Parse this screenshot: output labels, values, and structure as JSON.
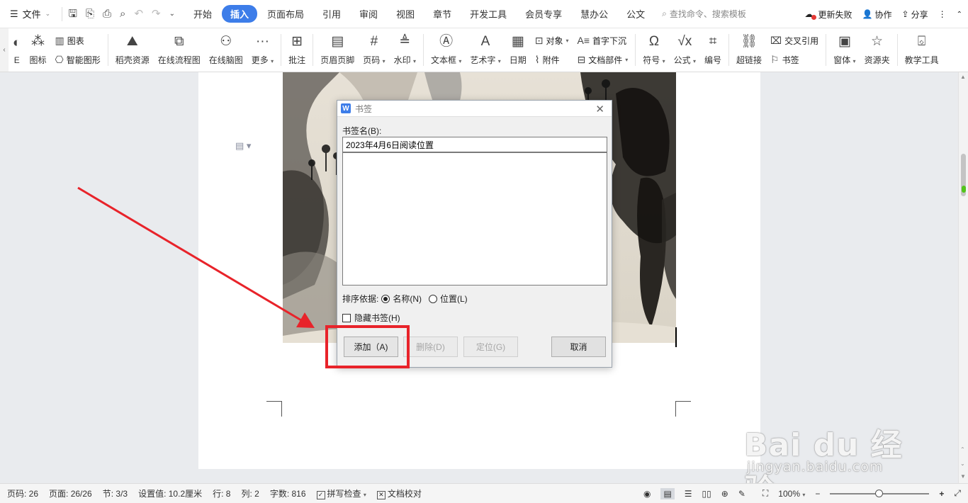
{
  "menubar": {
    "file_label": "文件",
    "tabs": [
      "开始",
      "插入",
      "页面布局",
      "引用",
      "审阅",
      "视图",
      "章节",
      "开发工具",
      "会员专享",
      "慧办公",
      "公文"
    ],
    "active_tab": "插入",
    "search_placeholder": "查找命令、搜索模板",
    "update_failed": "更新失败",
    "collab": "协作",
    "share": "分享"
  },
  "ribbon": {
    "partial_label": "E",
    "icon_label": "图标",
    "chart_label": "图表",
    "smartart_label": "智能图形",
    "docer_label": "稻壳资源",
    "flowchart_label": "在线流程图",
    "mindmap_label": "在线脑图",
    "more_label": "更多",
    "comment_label": "批注",
    "header_footer_label": "页眉页脚",
    "page_number_label": "页码",
    "watermark_label": "水印",
    "textbox_label": "文本框",
    "wordart_label": "艺术字",
    "date_label": "日期",
    "object_label": "对象",
    "attachment_label": "附件",
    "dropcap_label": "首字下沉",
    "docparts_label": "文档部件",
    "symbol_label": "符号",
    "formula_label": "公式",
    "numbering_label": "编号",
    "hyperlink_label": "超链接",
    "crossref_label": "交叉引用",
    "bookmark_label": "书签",
    "form_label": "窗体",
    "resource_label": "资源夹",
    "teaching_label": "教学工具"
  },
  "dialog": {
    "title": "书签",
    "name_label": "书签名(B):",
    "name_value": "2023年4月6日阅读位置",
    "sort_label": "排序依据:",
    "sort_name": "名称(N)",
    "sort_position": "位置(L)",
    "hide_label": "隐藏书签(H)",
    "add_button": "添加（A)",
    "delete_button": "删除(D)",
    "goto_button": "定位(G)",
    "cancel_button": "取消"
  },
  "statusbar": {
    "page": "页码: 26",
    "pages": "页面: 26/26",
    "section": "节: 3/3",
    "setting": "设置值: 10.2厘米",
    "row": "行: 8",
    "col": "列: 2",
    "words": "字数: 816",
    "spellcheck": "拼写检查",
    "proofread": "文档校对",
    "zoom": "100%"
  },
  "watermark": {
    "brand": "Bai du 经验",
    "url": "jingyan.baidu.com"
  },
  "colors": {
    "accent": "#3d7de9",
    "highlight": "#e8232a"
  }
}
